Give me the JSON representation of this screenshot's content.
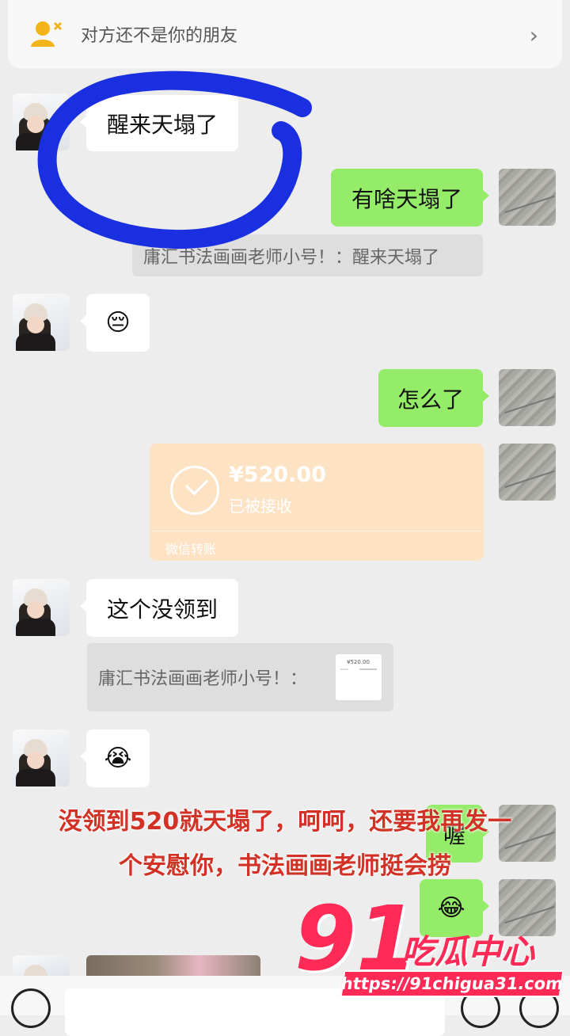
{
  "banner": {
    "text": "对方还不是你的朋友",
    "icon": "person-x-icon",
    "chevron": "›"
  },
  "messages": {
    "m1": "醒来天塌了",
    "m2": "有啥天塌了",
    "q1": "庸汇书法画画老师小号！：醒来天塌了",
    "m3": "😔",
    "m4": "怎么了",
    "m5": "这个没领到",
    "q2": "庸汇书法画画老师小号！：",
    "m6": "😭",
    "m7": "喔",
    "m8": "😂"
  },
  "transfer": {
    "amount": "¥520.00",
    "status": "已被接收",
    "footer": "微信转账",
    "thumb_amount": "¥520.00"
  },
  "overlay": {
    "line1": "没领到520就天塌了，呵呵，还要我再发一",
    "line2": "个安慰你，书法画画老师挺会捞"
  },
  "watermark": {
    "number": "91",
    "name": "吃瓜中心",
    "url": "https://91chigua31.com"
  },
  "colors": {
    "out_bubble": "#95ec69",
    "in_bubble": "#ffffff",
    "scribble": "#1a2fe0",
    "overlay_text": "#d23226",
    "watermark": "#ff2a55"
  }
}
